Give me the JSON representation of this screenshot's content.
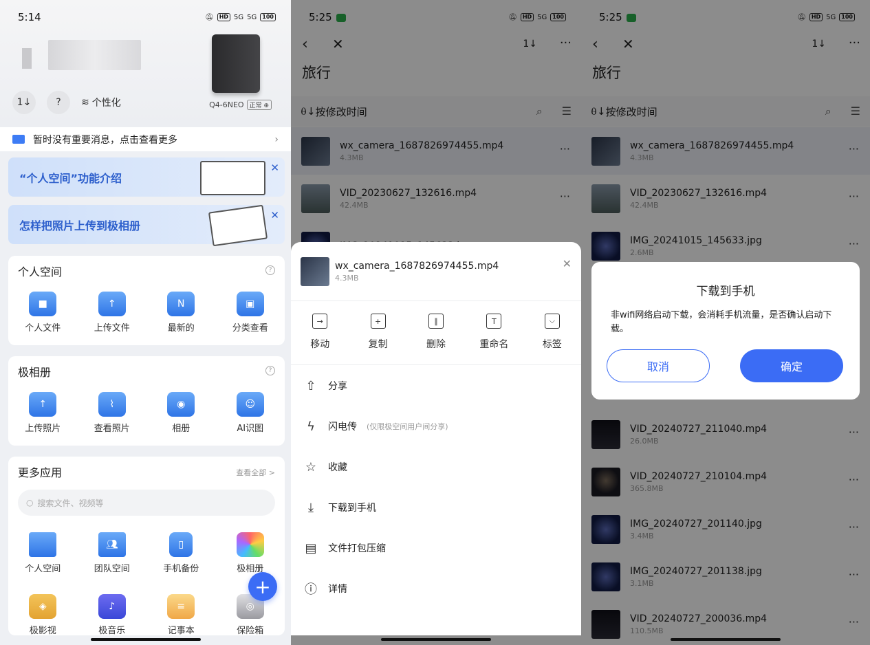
{
  "panel1": {
    "status": {
      "time": "5:14",
      "hd": "HD",
      "signal": "5G",
      "battery": "100"
    },
    "device": {
      "name": "Q4-6NEO",
      "status": "正常"
    },
    "actions": {
      "sort_icon": "1↓",
      "help_icon": "?",
      "personalize_label": "个性化"
    },
    "message": "暂时没有重要消息，点击查看更多",
    "banners": [
      "“个人空间”功能介绍",
      "怎样把照片上传到极相册"
    ],
    "personal_space": {
      "title": "个人空间",
      "items": [
        "个人文件",
        "上传文件",
        "最新的",
        "分类查看"
      ]
    },
    "album": {
      "title": "极相册",
      "items": [
        "上传照片",
        "查看照片",
        "相册",
        "AI识图"
      ]
    },
    "more_apps": {
      "title": "更多应用",
      "view_all": "查看全部 >",
      "search_placeholder": "搜索文件、视频等",
      "items": [
        "个人空间",
        "团队空间",
        "手机备份",
        "极相册"
      ],
      "items2": [
        "极影视",
        "极音乐",
        "记事本",
        "保险箱"
      ]
    }
  },
  "panel2": {
    "status": {
      "time": "5:25"
    },
    "header": {
      "title": "旅行",
      "sort": "1↓",
      "more": "···"
    },
    "sortbar": {
      "label": "按修改时间"
    },
    "files": [
      {
        "name": "wx_camera_1687826974455.mp4",
        "size": "4.3MB"
      },
      {
        "name": "VID_20230627_132616.mp4",
        "size": "42.4MB"
      },
      {
        "name": "IMG_20241015_145633.jpg",
        "size": ""
      }
    ],
    "sheet": {
      "file": {
        "name": "wx_camera_1687826974455.mp4",
        "size": "4.3MB"
      },
      "actions": [
        "移动",
        "复制",
        "删除",
        "重命名",
        "标签"
      ],
      "menu": [
        {
          "label": "分享",
          "note": ""
        },
        {
          "label": "闪电传",
          "note": "(仅限极空间用户间分享)"
        },
        {
          "label": "收藏",
          "note": ""
        },
        {
          "label": "下载到手机",
          "note": ""
        },
        {
          "label": "文件打包压缩",
          "note": ""
        },
        {
          "label": "详情",
          "note": ""
        }
      ]
    }
  },
  "panel3": {
    "status": {
      "time": "5:25"
    },
    "header": {
      "title": "旅行"
    },
    "sortbar": {
      "label": "按修改时间"
    },
    "files": [
      {
        "name": "wx_camera_1687826974455.mp4",
        "size": "4.3MB"
      },
      {
        "name": "VID_20230627_132616.mp4",
        "size": "42.4MB"
      },
      {
        "name": "IMG_20241015_145633.jpg",
        "size": "2.6MB"
      },
      {
        "name": "VID_20240727_211040.mp4",
        "size": "26.0MB"
      },
      {
        "name": "VID_20240727_210104.mp4",
        "size": "365.8MB"
      },
      {
        "name": "IMG_20240727_201140.jpg",
        "size": "3.4MB"
      },
      {
        "name": "IMG_20240727_201138.jpg",
        "size": "3.1MB"
      },
      {
        "name": "VID_20240727_200036.mp4",
        "size": "110.5MB"
      }
    ],
    "dialog": {
      "title": "下载到手机",
      "body": "非wifi网络启动下载，会消耗手机流量，是否确认启动下载。",
      "cancel": "取消",
      "confirm": "确定"
    }
  },
  "colors": {
    "accent": "#3b6cf5",
    "banner_text": "#2d5fcc"
  }
}
